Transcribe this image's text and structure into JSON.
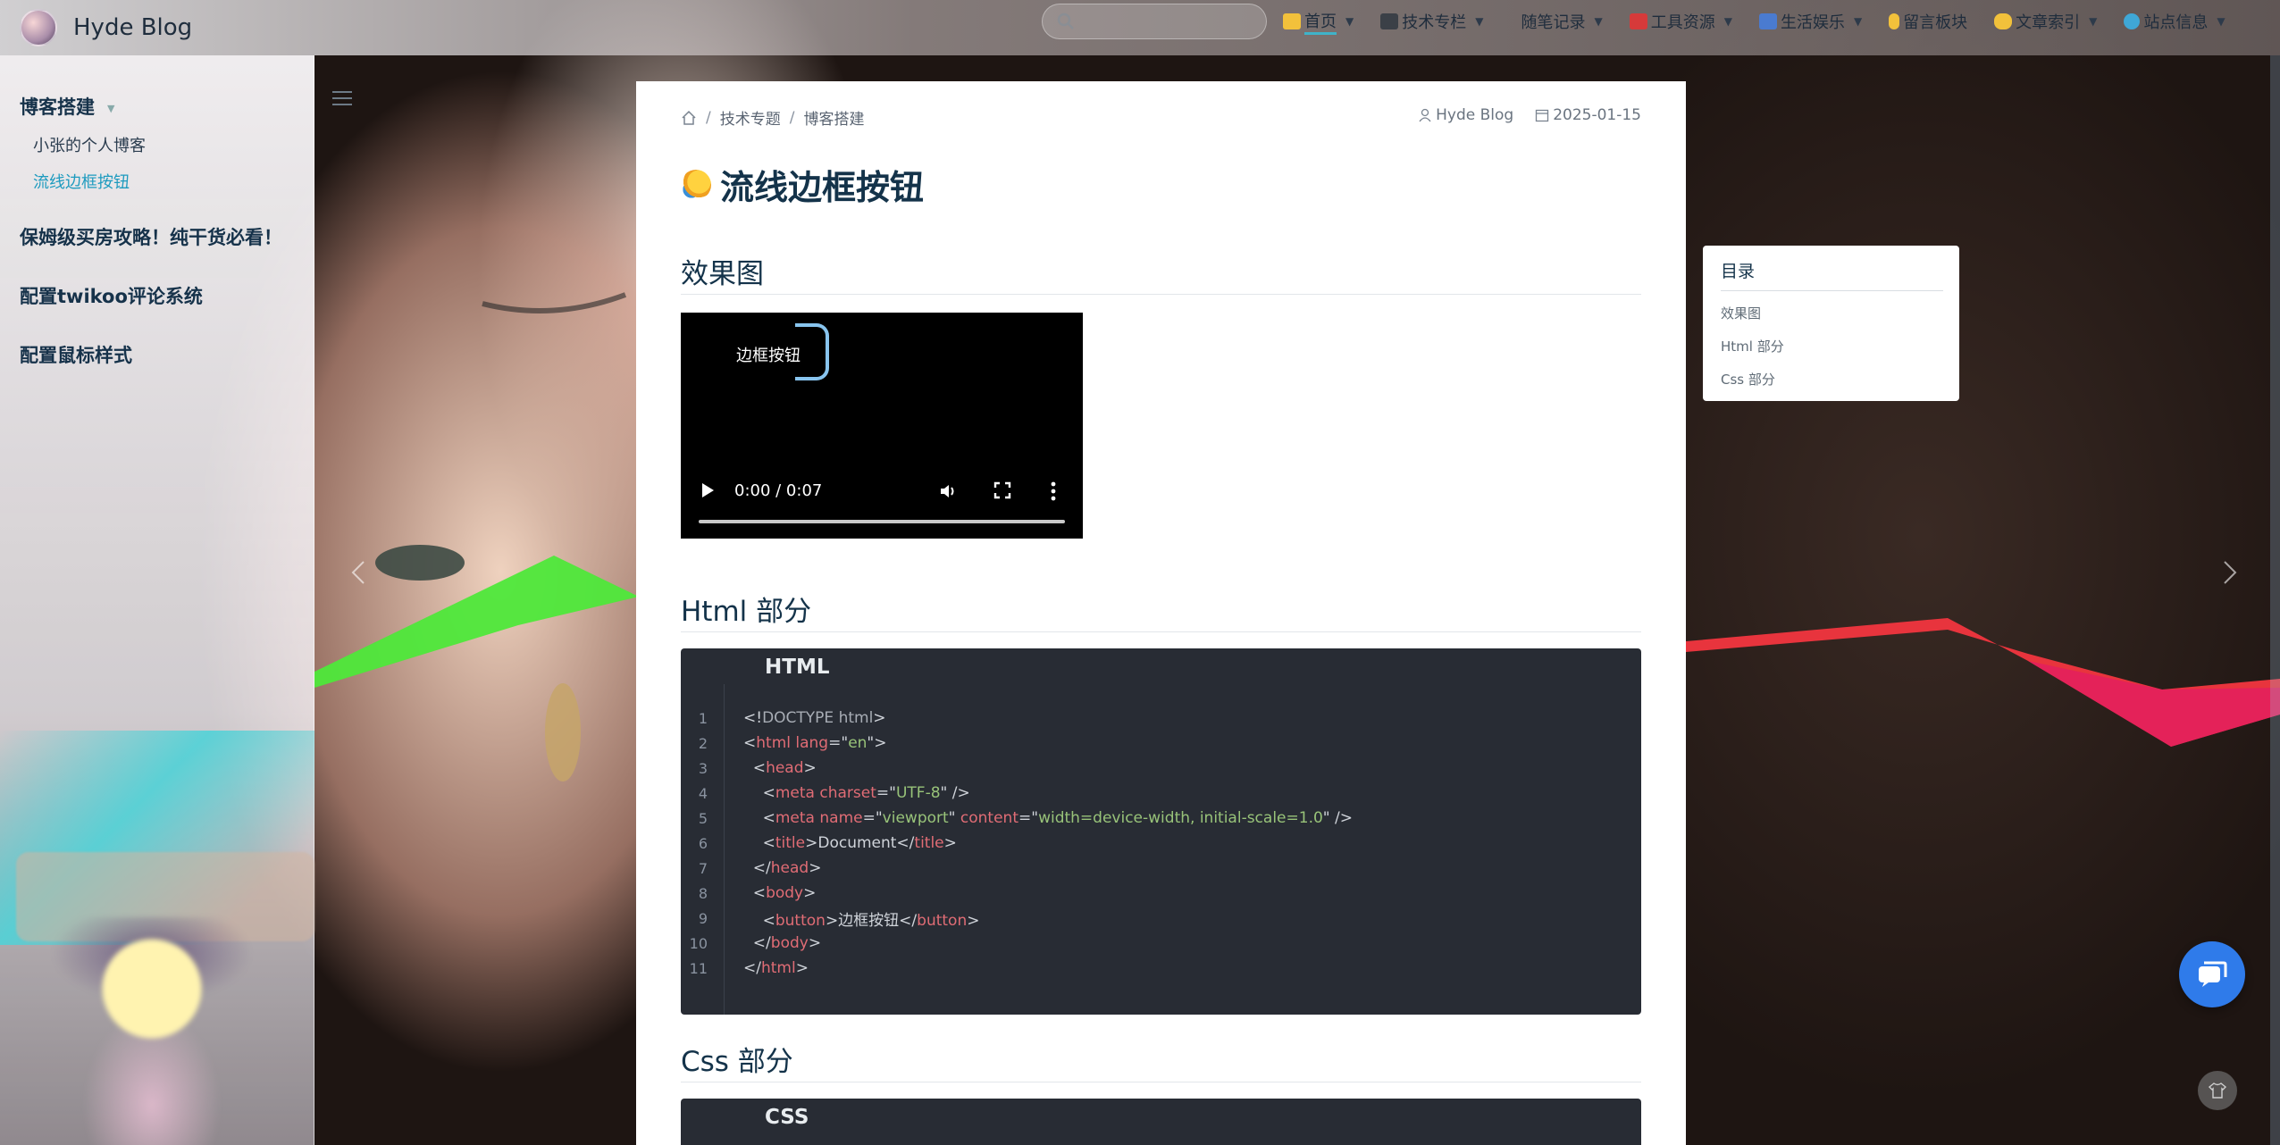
{
  "brand": {
    "title": "Hyde Blog"
  },
  "search": {
    "placeholder": ""
  },
  "nav": {
    "items": [
      {
        "label": "首页",
        "icon": "house-icon",
        "active": true
      },
      {
        "label": "技术专栏",
        "icon": "monitor-icon"
      },
      {
        "label": "随笔记录",
        "icon": "pen-icon"
      },
      {
        "label": "工具资源",
        "icon": "toolbox-icon"
      },
      {
        "label": "生活娱乐",
        "icon": "city-icon"
      },
      {
        "label": "留言板块",
        "icon": "ear-icon"
      },
      {
        "label": "文章索引",
        "icon": "hand-icon"
      },
      {
        "label": "站点信息",
        "icon": "globe-icon"
      }
    ]
  },
  "sidebar": {
    "groups": [
      {
        "label": "博客搭建",
        "children": [
          {
            "label": "小张的个人博客"
          },
          {
            "label": "流线边框按钮",
            "active": true
          }
        ]
      },
      {
        "label": "保姆级买房攻略！纯干货必看！"
      },
      {
        "label": "配置twikoo评论系统"
      },
      {
        "label": "配置鼠标样式"
      }
    ]
  },
  "breadcrumb": {
    "items": [
      "技术专题",
      "博客搭建"
    ],
    "separator": "/"
  },
  "meta": {
    "author": "Hyde Blog",
    "date": "2025-01-15"
  },
  "post": {
    "title": "流线边框按钮",
    "sections": [
      {
        "heading": "效果图"
      },
      {
        "heading": "Html 部分"
      },
      {
        "heading": "Css 部分"
      }
    ]
  },
  "video": {
    "button_label": "边框按钮",
    "time": "0:00 / 0:07",
    "progress": 0
  },
  "code_html": {
    "lang": "HTML",
    "lines": [
      "1",
      "2",
      "3",
      "4",
      "5",
      "6",
      "7",
      "8",
      "9",
      "10",
      "11"
    ],
    "text": {
      "l1_a": "<!",
      "l1_b": "DOCTYPE html",
      "l1_c": ">",
      "l2_a": "<",
      "l2_b": "html",
      "l2_c": " lang",
      "l2_d": "=\"",
      "l2_e": "en",
      "l2_f": "\">",
      "l3_a": "  <",
      "l3_b": "head",
      "l3_c": ">",
      "l4_a": "    <",
      "l4_b": "meta",
      "l4_c": " charset",
      "l4_d": "=\"",
      "l4_e": "UTF-8",
      "l4_f": "\" />",
      "l5_a": "    <",
      "l5_b": "meta",
      "l5_c": " name",
      "l5_d": "=\"",
      "l5_e": "viewport",
      "l5_f": "\"",
      "l5_g": " content",
      "l5_h": "=\"",
      "l5_i": "width=device-width, initial-scale=1.0",
      "l5_j": "\" />",
      "l6_a": "    <",
      "l6_b": "title",
      "l6_c": ">Document</",
      "l6_d": "title",
      "l6_e": ">",
      "l7_a": "  </",
      "l7_b": "head",
      "l7_c": ">",
      "l8_a": "  <",
      "l8_b": "body",
      "l8_c": ">",
      "l9_a": "    <",
      "l9_b": "button",
      "l9_c": ">边框按钮</",
      "l9_d": "button",
      "l9_e": ">",
      "l10_a": "  </",
      "l10_b": "body",
      "l10_c": ">",
      "l11_a": "</",
      "l11_b": "html",
      "l11_c": ">"
    }
  },
  "code_css": {
    "lang": "CSS"
  },
  "toc": {
    "title": "目录",
    "items": [
      "效果图",
      "Html 部分",
      "Css 部分"
    ]
  },
  "colors": {
    "accent": "#1e9bbf",
    "heading": "#14334a",
    "code_bg": "#282c34",
    "chat_button": "#2f7bea"
  }
}
